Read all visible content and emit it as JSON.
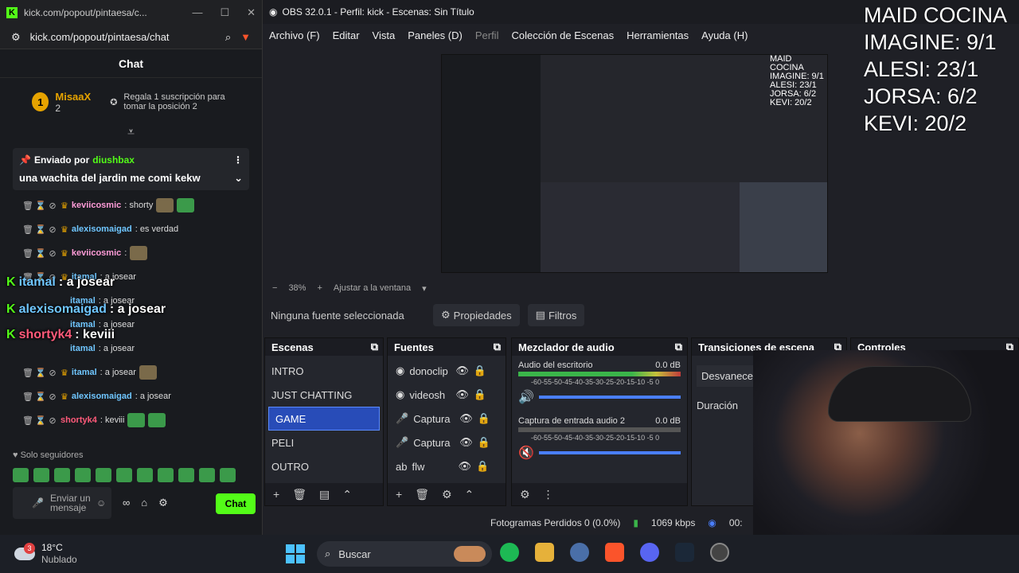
{
  "browser": {
    "tab_title": "kick.com/popout/pintaesa/c...",
    "url": "kick.com/popout/pintaesa/chat",
    "chat_title": "Chat",
    "gift": {
      "rank": "1",
      "user": "MisaaX",
      "count": "2",
      "text": "Regala 1 suscripción para tomar la posición 2"
    },
    "pinned": {
      "label": "Enviado por",
      "user": "diushbax",
      "message": "una wachita del jardin me comi kekw"
    },
    "messages": [
      {
        "user": "keviicosmic",
        "text": ": shorty"
      },
      {
        "user": "alexisomaigad",
        "text": ": es verdad"
      },
      {
        "user": "keviicosmic",
        "text": ":"
      },
      {
        "user": "itamal",
        "text": ": a josear"
      },
      {
        "user": "itamal",
        "text": ": a josear"
      },
      {
        "user": "itamal",
        "text": ": a josear"
      },
      {
        "user": "itamal",
        "text": ": a josear"
      },
      {
        "user": "itamal",
        "text": ": a josear"
      },
      {
        "user": "alexisomaigad",
        "text": ": a josear"
      },
      {
        "user": "shortyk4",
        "text": ": keviii"
      }
    ],
    "overlay": [
      {
        "user": "itamal",
        "text": ": a josear"
      },
      {
        "user": "alexisomaigad",
        "text": ": a josear"
      },
      {
        "user": "shortyk4",
        "text": ": keviii"
      },
      {
        "text": "a josear"
      }
    ],
    "followers": "Solo seguidores",
    "input_placeholder": "Enviar un mensaje",
    "chat_button": "Chat"
  },
  "obs": {
    "title": "OBS 32.0.1 - Perfil: kick - Escenas: Sin Título",
    "menu": [
      "Archivo (F)",
      "Editar",
      "Vista",
      "Paneles (D)",
      "Perfil",
      "Colección de Escenas",
      "Herramientas",
      "Ayuda (H)"
    ],
    "zoom": "38%",
    "fit": "Ajustar a la ventana",
    "nosource": "Ninguna fuente seleccionada",
    "props": "Propiedades",
    "filters": "Filtros",
    "scenes_title": "Escenas",
    "scenes": [
      "INTRO",
      "JUST CHATTING",
      "GAME",
      "PELI",
      "OUTRO"
    ],
    "sources_title": "Fuentes",
    "sources": [
      "donoclip",
      "videosh",
      "Captura",
      "Captura",
      "flw"
    ],
    "mixer_title": "Mezclador de audio",
    "mixer": [
      {
        "name": "Audio del escritorio",
        "db": "0.0 dB"
      },
      {
        "name": "Captura de entrada audio 2",
        "db": "0.0 dB"
      }
    ],
    "scale": "-60-55-50-45-40-35-30-25-20-15-10 -5  0",
    "transitions_title": "Transiciones de escena",
    "transition": "Desvanecer",
    "duration": "Duración",
    "controls_title": "Controles",
    "frames": "Fotogramas Perdidos 0 (0.0%)",
    "kbps": "1069 kbps",
    "time": "00:"
  },
  "scoreboard": [
    "MAID COCINA",
    "IMAGINE: 9/1",
    "ALESI: 23/1",
    "JORSA: 6/2",
    "KEVI: 20/2"
  ],
  "mini_scoreboard": [
    "MAID COCINA",
    "IMAGINE: 9/1",
    "ALESI: 23/1",
    "JORSA: 6/2",
    "KEVI: 20/2"
  ],
  "taskbar": {
    "temp": "18°C",
    "condition": "Nublado",
    "badge": "3",
    "search": "Buscar"
  }
}
